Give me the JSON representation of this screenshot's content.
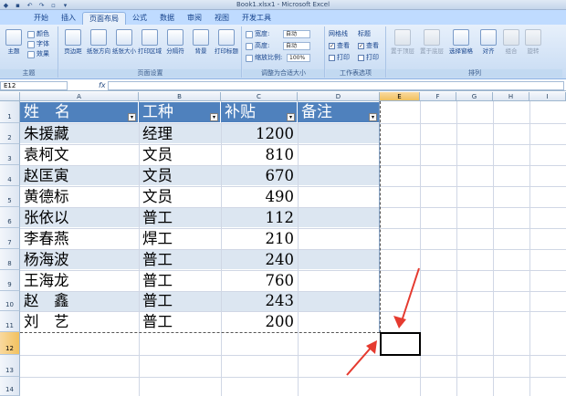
{
  "window": {
    "title": "Book1.xlsx1 - Microsoft Excel"
  },
  "ribbon": {
    "tabs": [
      "开始",
      "插入",
      "页面布局",
      "公式",
      "数据",
      "审阅",
      "视图",
      "开发工具"
    ],
    "active_tab": "页面布局",
    "groups": {
      "theme": {
        "label": "主题",
        "big": "主题",
        "colors": "颜色",
        "fonts": "字体",
        "effects": "效果"
      },
      "page_setup": {
        "label": "页面设置",
        "buttons": [
          "页边距",
          "纸张方向",
          "纸张大小",
          "打印区域",
          "分隔符",
          "背景",
          "打印标题"
        ]
      },
      "scale": {
        "label": "调整为合适大小",
        "width_label": "宽度:",
        "width_value": "自动",
        "height_label": "高度:",
        "height_value": "自动",
        "zoom_label": "缩放比例:",
        "zoom_value": "100%"
      },
      "sheet_options": {
        "label": "工作表选项",
        "gridlines": "网格线",
        "headings": "标题",
        "view": "查看",
        "print": "打印"
      },
      "arrange": {
        "label": "排列",
        "buttons": [
          "置于顶层",
          "置于底层",
          "选择窗格",
          "对齐",
          "组合",
          "旋转"
        ]
      }
    }
  },
  "formula_bar": {
    "name_box": "E12",
    "fx": "fx",
    "value": ""
  },
  "columns": [
    "A",
    "B",
    "C",
    "D",
    "E",
    "F",
    "G",
    "H",
    "I"
  ],
  "selected_column": "E",
  "rows": [
    "1",
    "2",
    "3",
    "4",
    "5",
    "6",
    "7",
    "8",
    "9",
    "10",
    "11",
    "12",
    "13",
    "14"
  ],
  "selected_row": "12",
  "table": {
    "headers": [
      "姓　名",
      "工种",
      "补贴",
      "备注"
    ],
    "records": [
      [
        "朱援藏",
        "经理",
        "1200",
        ""
      ],
      [
        "袁柯文",
        "文员",
        "810",
        ""
      ],
      [
        "赵匡寅",
        "文员",
        "670",
        ""
      ],
      [
        "黄德标",
        "文员",
        "490",
        ""
      ],
      [
        "张依以",
        "普工",
        "112",
        ""
      ],
      [
        "李春燕",
        "焊工",
        "210",
        ""
      ],
      [
        "杨海波",
        "普工",
        "240",
        ""
      ],
      [
        "王海龙",
        "普工",
        "760",
        ""
      ],
      [
        "赵　鑫",
        "普工",
        "243",
        ""
      ],
      [
        "刘　艺",
        "普工",
        "200",
        ""
      ]
    ]
  },
  "colors": {
    "header_fill": "#4f81bd",
    "band_fill": "#dce6f1",
    "annotation_red": "#e53a2f"
  }
}
